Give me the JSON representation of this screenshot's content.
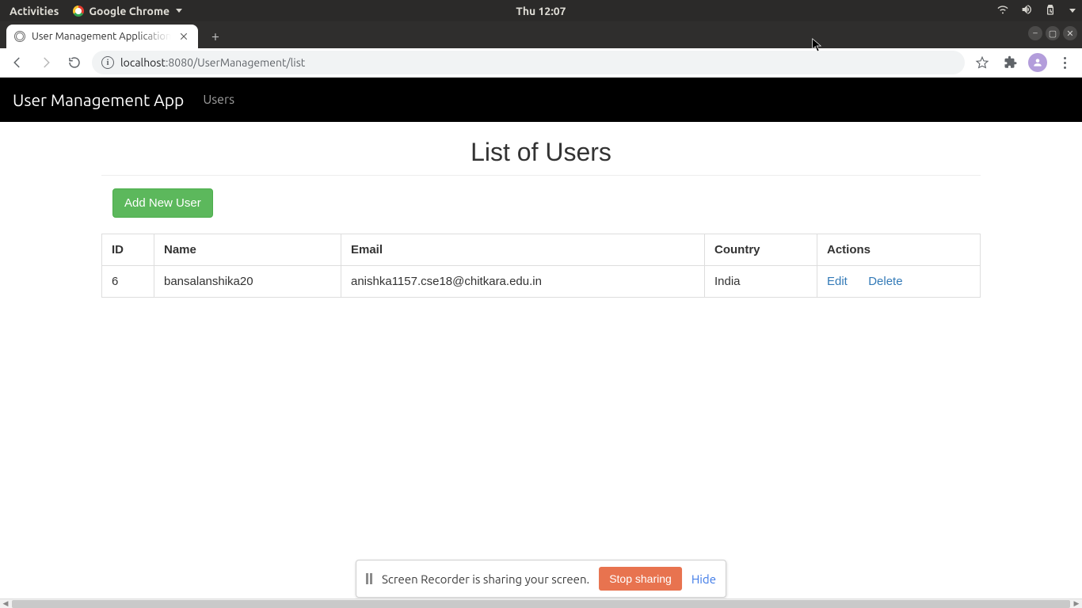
{
  "gnome": {
    "activities": "Activities",
    "app_name": "Google Chrome",
    "clock": "Thu 12:07"
  },
  "browser": {
    "tab_title": "User Management Application",
    "url_host": "localhost",
    "url_port": ":8080",
    "url_path": "/UserManagement/list"
  },
  "nav": {
    "brand": "User Management App",
    "users_link": "Users"
  },
  "page": {
    "title": "List of Users",
    "add_button": "Add New User"
  },
  "table": {
    "headers": {
      "id": "ID",
      "name": "Name",
      "email": "Email",
      "country": "Country",
      "actions": "Actions"
    },
    "rows": [
      {
        "id": "6",
        "name": "bansalanshika20",
        "email": "anishka1157.cse18@chitkara.edu.in",
        "country": "India",
        "edit": "Edit",
        "delete": "Delete"
      }
    ]
  },
  "sharebar": {
    "text": "Screen Recorder is sharing your screen.",
    "stop": "Stop sharing",
    "hide": "Hide"
  }
}
